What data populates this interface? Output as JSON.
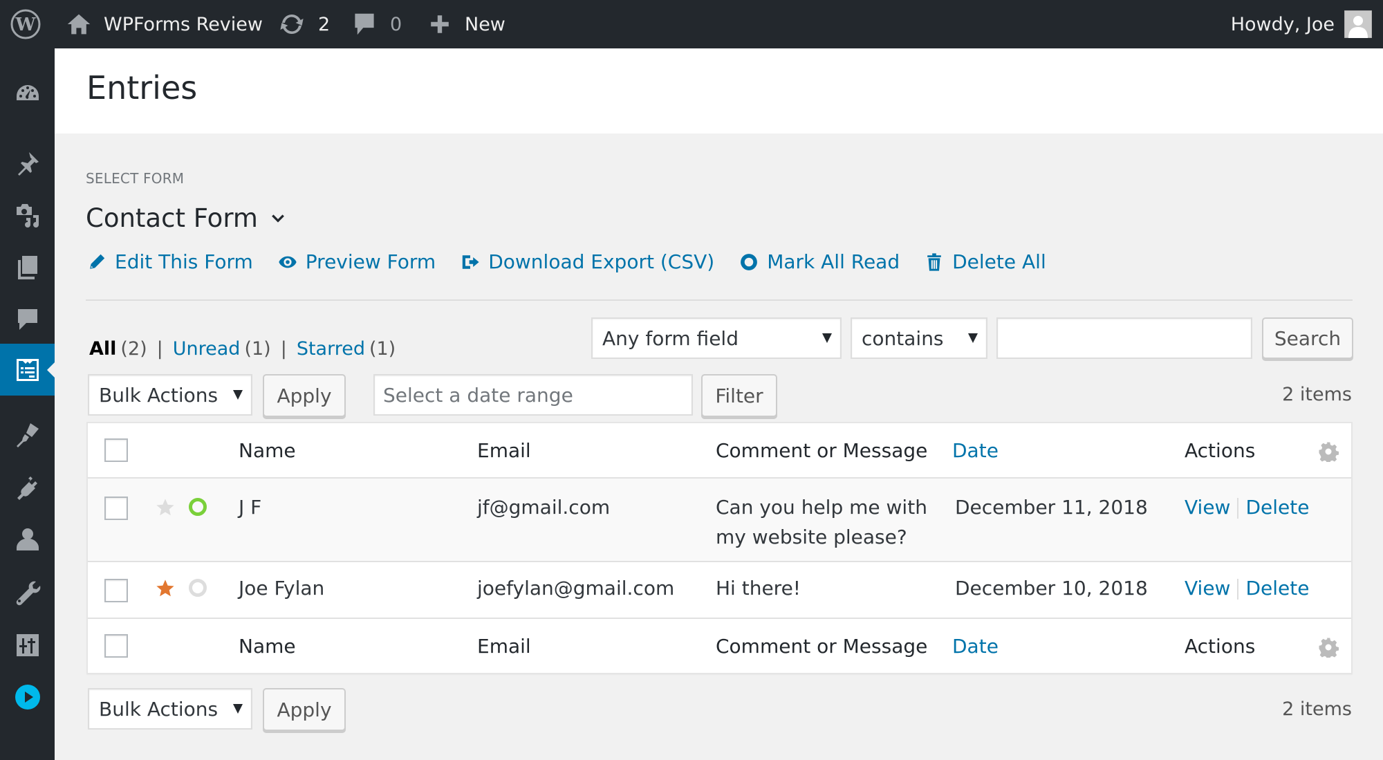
{
  "adminbar": {
    "site_name": "WPForms Review",
    "updates_count": "2",
    "comments_count": "0",
    "new_label": "New",
    "howdy": "Howdy, Joe"
  },
  "sidebar": {
    "items": [
      {
        "name": "dashboard",
        "active": false
      },
      {
        "name": "posts",
        "active": false
      },
      {
        "name": "media",
        "active": false
      },
      {
        "name": "pages",
        "active": false
      },
      {
        "name": "comments",
        "active": false
      },
      {
        "name": "wpforms",
        "active": true
      },
      {
        "name": "appearance",
        "active": false
      },
      {
        "name": "plugins",
        "active": false
      },
      {
        "name": "users",
        "active": false
      },
      {
        "name": "tools",
        "active": false
      },
      {
        "name": "settings",
        "active": false
      },
      {
        "name": "media-player",
        "active": false
      }
    ]
  },
  "page": {
    "title": "Entries",
    "select_form_label": "SELECT FORM",
    "form_name": "Contact Form",
    "actions": {
      "edit": "Edit This Form",
      "preview": "Preview Form",
      "export": "Download Export (CSV)",
      "mark_read": "Mark All Read",
      "delete_all": "Delete All"
    }
  },
  "views": {
    "all_label": "All",
    "all_count": "(2)",
    "unread_label": "Unread",
    "unread_count": "(1)",
    "starred_label": "Starred",
    "starred_count": "(1)",
    "separator": "|"
  },
  "search": {
    "field_select": "Any form field",
    "comparison_select": "contains",
    "term_value": "",
    "button_label": "Search"
  },
  "tablenav_top": {
    "bulk_actions": "Bulk Actions",
    "apply_label": "Apply",
    "date_placeholder": "Select a date range",
    "filter_label": "Filter",
    "items_count": "2 items"
  },
  "table": {
    "columns": {
      "name": "Name",
      "email": "Email",
      "message": "Comment or Message",
      "date": "Date",
      "actions": "Actions"
    },
    "rows": [
      {
        "name": "J F",
        "email": "jf@gmail.com",
        "message_line1": "Can you help me with",
        "message_line2": "my website please?",
        "date": "December 11, 2018",
        "starred": false,
        "unread": true,
        "view": "View",
        "delete": "Delete"
      },
      {
        "name": "Joe Fylan",
        "email": "joefylan@gmail.com",
        "message_line1": "Hi there!",
        "date": "December 10, 2018",
        "starred": true,
        "unread": false,
        "view": "View",
        "delete": "Delete"
      }
    ]
  },
  "tablenav_bottom": {
    "bulk_actions": "Bulk Actions",
    "apply_label": "Apply",
    "items_count": "2 items"
  },
  "colors": {
    "adminbar_bg": "#23282d",
    "accent": "#0073aa",
    "star_active": "#e27730",
    "star_inactive": "#dddddd",
    "unread_dot": "#7ad03a",
    "read_dot": "#dddddd",
    "media_player_accent": "#00b9eb"
  }
}
